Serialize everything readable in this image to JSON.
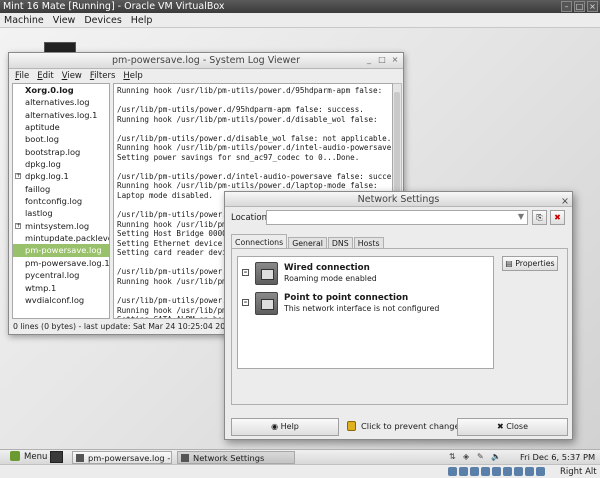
{
  "vbox": {
    "title": "Mint 16 Mate [Running] - Oracle VM VirtualBox",
    "menu": [
      "Machine",
      "View",
      "Devices",
      "Help"
    ],
    "host_key": "Right Alt"
  },
  "logviewer": {
    "title": "pm-powersave.log - System Log Viewer",
    "menu": [
      {
        "label": "File",
        "mnemonic": "F",
        "rest": "ile"
      },
      {
        "label": "Edit",
        "mnemonic": "E",
        "rest": "dit"
      },
      {
        "label": "View",
        "mnemonic": "V",
        "rest": "iew"
      },
      {
        "label": "Filters",
        "mnemonic": "F",
        "rest": "ilters"
      },
      {
        "label": "Help",
        "mnemonic": "H",
        "rest": "elp"
      }
    ],
    "files": [
      {
        "name": "Xorg.0.log",
        "bold": true
      },
      {
        "name": "alternatives.log"
      },
      {
        "name": "alternatives.log.1"
      },
      {
        "name": "aptitude"
      },
      {
        "name": "boot.log"
      },
      {
        "name": "bootstrap.log"
      },
      {
        "name": "dpkg.log"
      },
      {
        "name": "dpkg.log.1",
        "expander": true
      },
      {
        "name": "faillog"
      },
      {
        "name": "fontconfig.log"
      },
      {
        "name": "lastlog"
      },
      {
        "name": "mintsystem.log",
        "expander": true
      },
      {
        "name": "mintupdate.packlevel"
      },
      {
        "name": "pm-powersave.log",
        "selected": true
      },
      {
        "name": "pm-powersave.log.1"
      },
      {
        "name": "pycentral.log"
      },
      {
        "name": "wtmp.1"
      },
      {
        "name": "wvdialconf.log"
      }
    ],
    "lines": [
      "Running hook /usr/lib/pm-utils/power.d/95hdparm-apm false:",
      "",
      "/usr/lib/pm-utils/power.d/95hdparm-apm false: success.",
      "Running hook /usr/lib/pm-utils/power.d/disable_wol false:",
      "",
      "/usr/lib/pm-utils/power.d/disable_wol false: not applicable.",
      "Running hook /usr/lib/pm-utils/power.d/intel-audio-powersave",
      "Setting power savings for snd_ac97_codec to 0...Done.",
      "",
      "/usr/lib/pm-utils/power.d/intel-audio-powersave false: succes",
      "Running hook /usr/lib/pm-utils/power.d/laptop-mode false:",
      "Laptop mode disabled.",
      "",
      "/usr/lib/pm-utils/power.",
      "Running hook /usr/lib/pm",
      "Setting Host Bridge 0000",
      "Setting Ethernet device",
      "Setting card reader devi",
      "",
      "/usr/lib/pm-utils/power.",
      "Running hook /usr/lib/pm",
      "",
      "/usr/lib/pm-utils/power.",
      "Running hook /usr/lib/pm",
      "Setting SATA ALPM on hos",
      "",
      "/usr/lib/pm-utils/power."
    ],
    "status": "0 lines (0 bytes) - last update: Sat Mar 24 10:25:04 2012"
  },
  "network": {
    "title": "Network Settings",
    "location_label": "Location:",
    "location_value": "",
    "tabs": [
      {
        "label": "Connections",
        "active": true
      },
      {
        "label": "General"
      },
      {
        "label": "DNS"
      },
      {
        "label": "Hosts"
      }
    ],
    "connections": [
      {
        "name": "Wired connection",
        "desc": "Roaming mode enabled"
      },
      {
        "name": "Point to point connection",
        "desc": "This network interface is not configured"
      }
    ],
    "properties_label": "Properties",
    "help_label": "Help",
    "lock_label": "Click to prevent changes",
    "close_label": "Close"
  },
  "taskbar": {
    "menu_label": "Menu",
    "tasks": [
      {
        "label": "pm-powersave.log - S..."
      },
      {
        "label": "Network Settings",
        "active": true
      }
    ],
    "clock": "Fri Dec  6,  5:37 PM"
  }
}
